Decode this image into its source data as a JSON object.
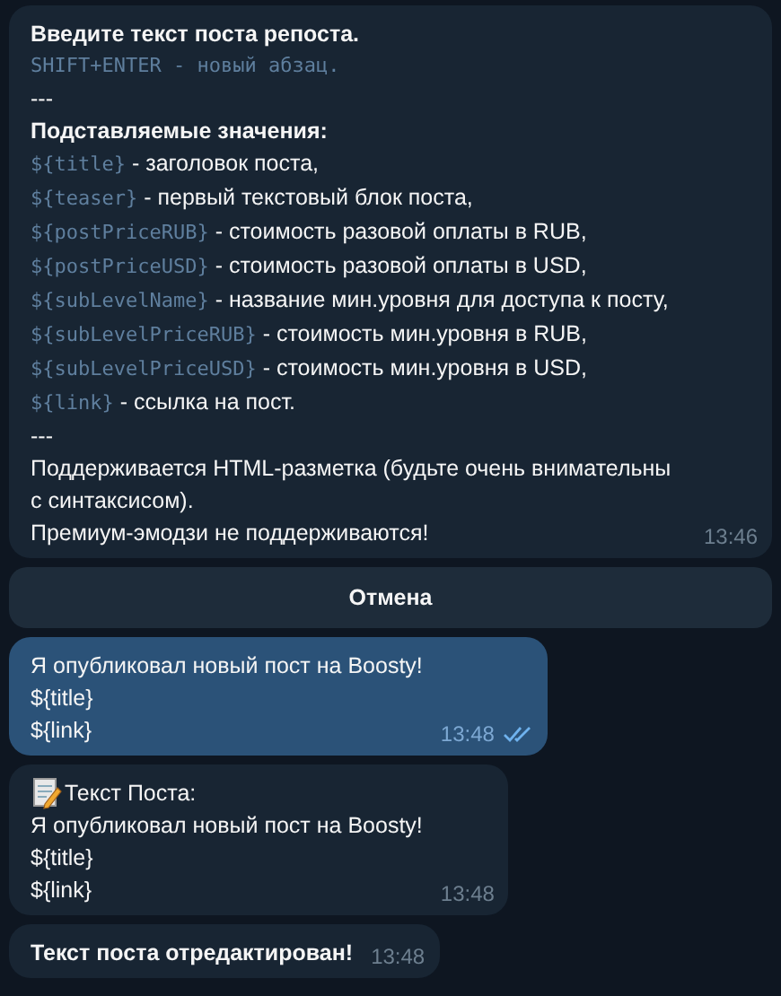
{
  "messages": [
    {
      "kind": "incoming",
      "time": "13:46",
      "lines": [
        {
          "kind": "heading",
          "text": "Введите текст поста репоста."
        },
        {
          "kind": "code",
          "text": "SHIFT+ENTER - новый абзац."
        },
        {
          "kind": "plain",
          "text": "---"
        },
        {
          "kind": "heading",
          "text": "Подставляемые значения:"
        },
        {
          "kind": "var",
          "code": "${title}",
          "text": " - заголовок поста,"
        },
        {
          "kind": "var",
          "code": "${teaser}",
          "text": " - первый текстовый блок поста,"
        },
        {
          "kind": "var",
          "code": "${postPriceRUB}",
          "text": " - стоимость разовой оплаты в RUB,"
        },
        {
          "kind": "var",
          "code": "${postPriceUSD}",
          "text": " - стоимость разовой оплаты в USD,"
        },
        {
          "kind": "var",
          "code": "${subLevelName}",
          "text": " - название мин.уровня для доступа к посту,"
        },
        {
          "kind": "var",
          "code": "${subLevelPriceRUB}",
          "text": " - стоимость мин.уровня в RUB,"
        },
        {
          "kind": "var",
          "code": "${subLevelPriceUSD}",
          "text": " - стоимость мин.уровня в USD,"
        },
        {
          "kind": "var",
          "code": "${link}",
          "text": " - ссылка на пост."
        },
        {
          "kind": "plain",
          "text": "---"
        },
        {
          "kind": "plain",
          "text": "Поддерживается HTML-разметка (будьте очень внимательны с синтаксисом)."
        },
        {
          "kind": "plain",
          "text": "Премиум-эмодзи не поддерживаются!"
        }
      ]
    },
    {
      "kind": "button",
      "text": "Отмена"
    },
    {
      "kind": "outgoing",
      "time": "13:48",
      "read": true,
      "lines": [
        {
          "kind": "plain",
          "text": "Я опубликовал новый пост на Boosty!"
        },
        {
          "kind": "plain",
          "text": "${title}"
        },
        {
          "kind": "plain",
          "text": "${link}"
        }
      ]
    },
    {
      "kind": "incoming",
      "time": "13:48",
      "lines": [
        {
          "kind": "memo",
          "text": "Текст Поста:"
        },
        {
          "kind": "plain",
          "text": "Я опубликовал новый пост на Boosty!"
        },
        {
          "kind": "plain",
          "text": "${title}"
        },
        {
          "kind": "plain",
          "text": "${link}"
        }
      ]
    },
    {
      "kind": "incoming",
      "time": "13:48",
      "lines": [
        {
          "kind": "heading",
          "text": "Текст поста отредактирован!"
        }
      ]
    }
  ]
}
